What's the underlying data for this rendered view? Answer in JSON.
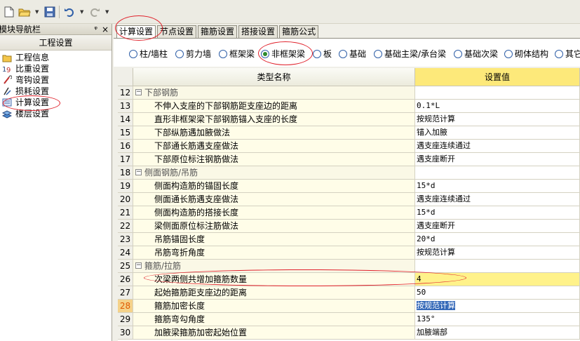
{
  "toolbar": {
    "icons": [
      "new-file-icon",
      "open-folder-icon",
      "save-icon",
      "undo-icon",
      "redo-icon"
    ]
  },
  "left_panel": {
    "title": "模块导航栏",
    "pin": "ᵠ",
    "close": "×",
    "header": "工程设置",
    "items": [
      {
        "label": "工程信息",
        "icon": "project-info-icon"
      },
      {
        "label": "比重设置",
        "icon": "weight-icon"
      },
      {
        "label": "弯钩设置",
        "icon": "hook-icon"
      },
      {
        "label": "损耗设置",
        "icon": "loss-icon"
      },
      {
        "label": "计算设置",
        "icon": "calc-icon"
      },
      {
        "label": "楼层设置",
        "icon": "floor-icon"
      }
    ]
  },
  "tabs": [
    {
      "label": "计算设置",
      "active": true
    },
    {
      "label": "节点设置",
      "active": false
    },
    {
      "label": "箍筋设置",
      "active": false
    },
    {
      "label": "搭接设置",
      "active": false
    },
    {
      "label": "箍筋公式",
      "active": false
    }
  ],
  "radios": [
    {
      "label": "柱/墙柱",
      "checked": false
    },
    {
      "label": "剪力墙",
      "checked": false
    },
    {
      "label": "框架梁",
      "checked": false
    },
    {
      "label": "非框架梁",
      "checked": true
    },
    {
      "label": "板",
      "checked": false
    },
    {
      "label": "基础",
      "checked": false
    },
    {
      "label": "基础主梁/承台梁",
      "checked": false
    },
    {
      "label": "基础次梁",
      "checked": false
    },
    {
      "label": "砌体结构",
      "checked": false
    },
    {
      "label": "其它",
      "checked": false
    }
  ],
  "grid": {
    "col_name": "类型名称",
    "col_value": "设置值",
    "rows": [
      {
        "num": "12",
        "name": "下部钢筋",
        "value": "",
        "group": true
      },
      {
        "num": "13",
        "name": "不伸入支座的下部钢筋距支座边的距离",
        "value": "0.1*L"
      },
      {
        "num": "14",
        "name": "直形非框架梁下部钢筋锚入支座的长度",
        "value": "按规范计算"
      },
      {
        "num": "15",
        "name": "下部纵筋遇加腋做法",
        "value": "锚入加腋"
      },
      {
        "num": "16",
        "name": "下部通长筋遇支座做法",
        "value": "遇支座连续通过"
      },
      {
        "num": "17",
        "name": "下部原位标注钢筋做法",
        "value": "遇支座断开"
      },
      {
        "num": "18",
        "name": "侧面钢筋/吊筋",
        "value": "",
        "group": true
      },
      {
        "num": "19",
        "name": "侧面构造筋的锚固长度",
        "value": "15*d"
      },
      {
        "num": "20",
        "name": "侧面通长筋遇支座做法",
        "value": "遇支座连续通过"
      },
      {
        "num": "21",
        "name": "侧面构造筋的搭接长度",
        "value": "15*d"
      },
      {
        "num": "22",
        "name": "梁侧面原位标注筋做法",
        "value": "遇支座断开"
      },
      {
        "num": "23",
        "name": "吊筋锚固长度",
        "value": "20*d"
      },
      {
        "num": "24",
        "name": "吊筋弯折角度",
        "value": "按规范计算"
      },
      {
        "num": "25",
        "name": "箍筋/拉筋",
        "value": "",
        "group": true
      },
      {
        "num": "26",
        "name": "次梁两侧共增加箍筋数量",
        "value": "4",
        "yellow": true
      },
      {
        "num": "27",
        "name": "起始箍筋距支座边的距离",
        "value": "50"
      },
      {
        "num": "28",
        "name": "箍筋加密长度",
        "value": "按规范计算",
        "current": true
      },
      {
        "num": "29",
        "name": "箍筋弯勾角度",
        "value": "135°"
      },
      {
        "num": "30",
        "name": "加腋梁箍筋加密起始位置",
        "value": "加腋端部"
      }
    ]
  },
  "annotation_color": "#e0202a"
}
